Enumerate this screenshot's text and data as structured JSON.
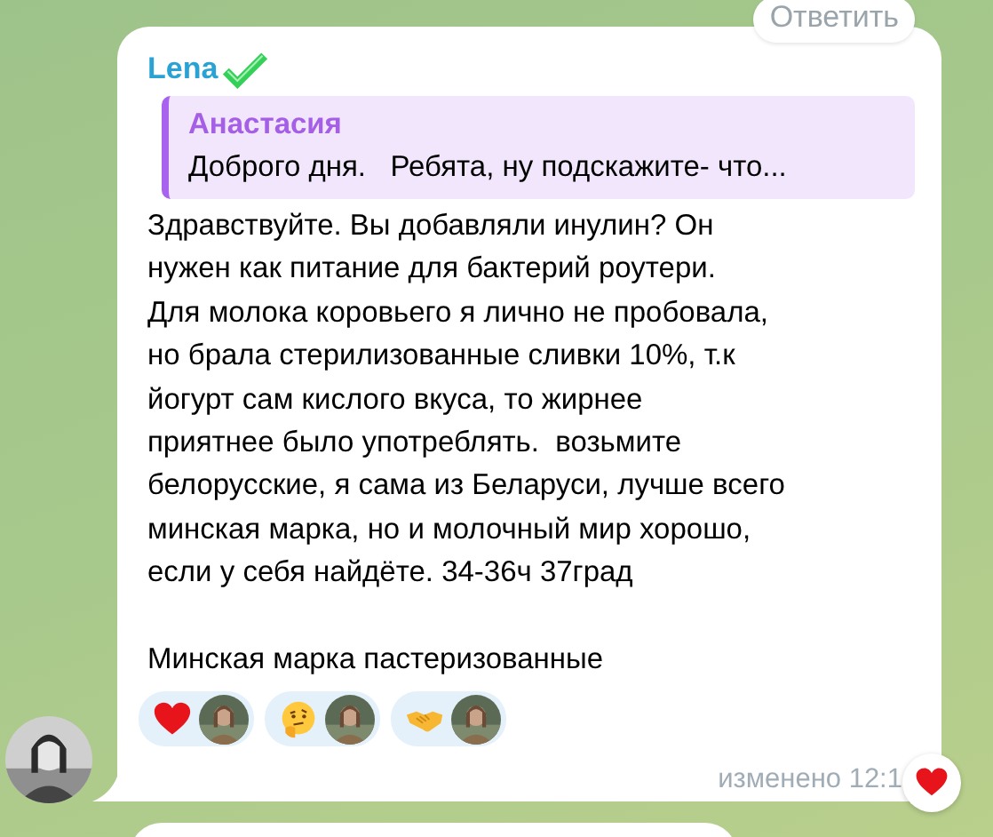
{
  "message": {
    "sender": "Lena",
    "verified": true,
    "reply": {
      "author": "Анастасия",
      "text": "Доброго дня.   Ребята, ну подскажите- что..."
    },
    "text": "Здравствуйте. Вы добавляли инулин? Он\nнужен как питание для бактерий роутери.\nДля молока коровьего я лично не пробовала,\nно брала стерилизованные сливки 10%, т.к\nйогурт сам кислого вкуса, то жирнее\nприятнее было употреблять.  возьмите\nбелорусские, я сама из Беларуси, лучше всего\nминская марка, но и молочный мир хорошо,\nесли у себя найдёте. 34-36ч 37град\n\nМинская марка пастеризованные",
    "reactions": [
      {
        "kind": "heart"
      },
      {
        "kind": "thinking"
      },
      {
        "kind": "handshake"
      }
    ],
    "edited": "изменено 12:1",
    "badge": {
      "kind": "heart"
    },
    "reply_action": "Ответить"
  }
}
